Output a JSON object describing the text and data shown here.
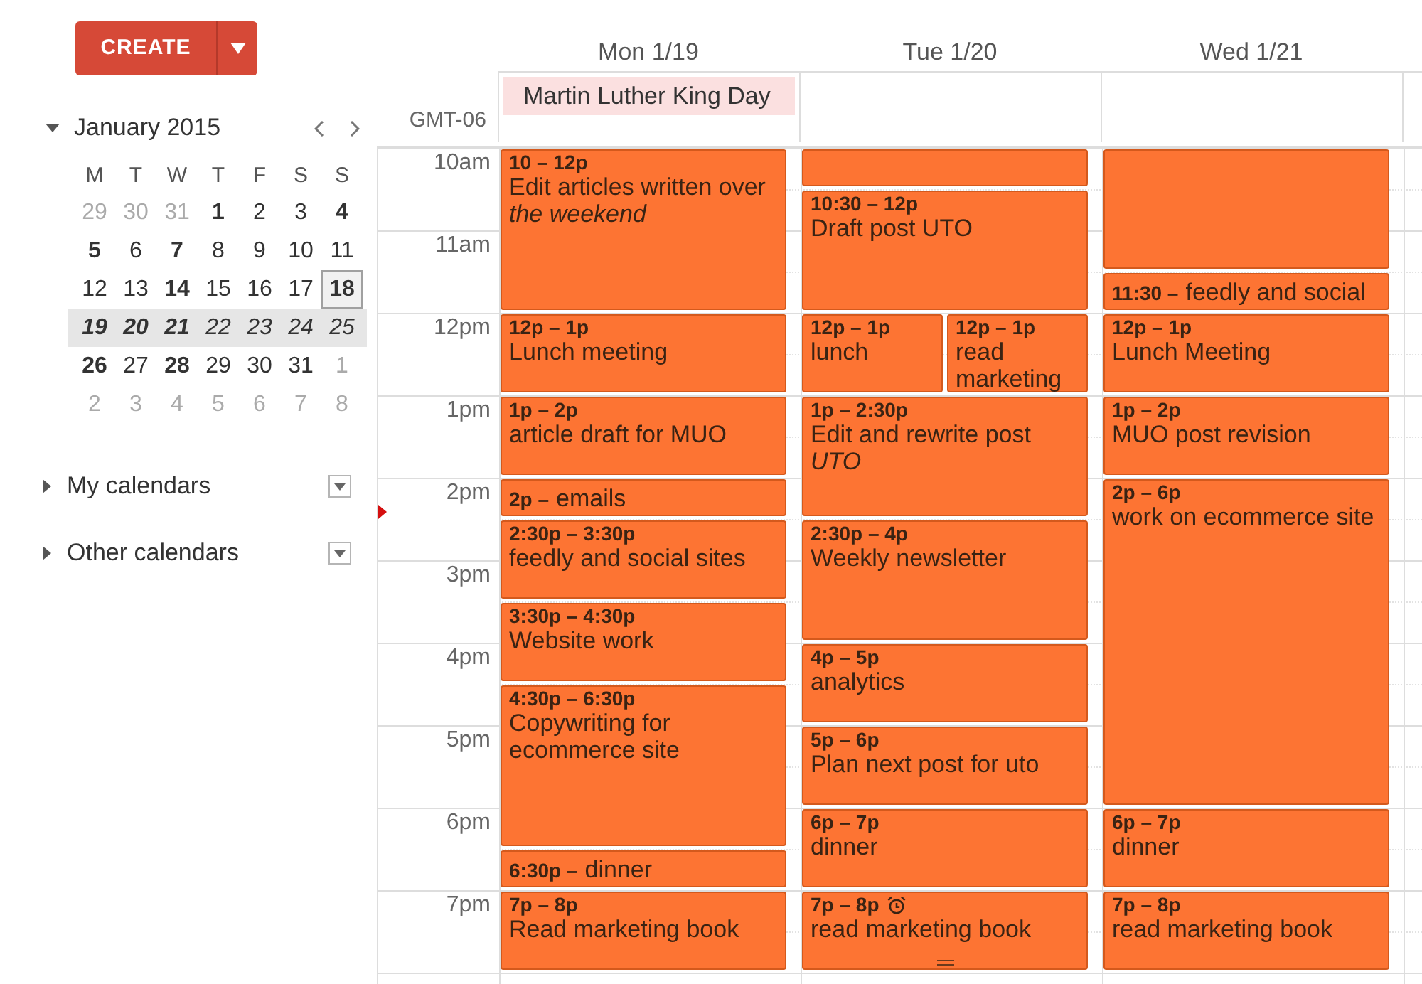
{
  "create_button": {
    "label": "CREATE"
  },
  "mini_calendar": {
    "title": "January 2015",
    "expanded": true,
    "weekdays": [
      "M",
      "T",
      "W",
      "T",
      "F",
      "S",
      "S"
    ],
    "weeks": [
      {
        "selected": false,
        "days": [
          {
            "label": "29",
            "muted": true,
            "bold": false,
            "today": false
          },
          {
            "label": "30",
            "muted": true,
            "bold": false,
            "today": false
          },
          {
            "label": "31",
            "muted": true,
            "bold": false,
            "today": false
          },
          {
            "label": "1",
            "muted": false,
            "bold": true,
            "today": false
          },
          {
            "label": "2",
            "muted": false,
            "bold": false,
            "today": false
          },
          {
            "label": "3",
            "muted": false,
            "bold": false,
            "today": false
          },
          {
            "label": "4",
            "muted": false,
            "bold": true,
            "today": false
          }
        ]
      },
      {
        "selected": false,
        "days": [
          {
            "label": "5",
            "muted": false,
            "bold": true,
            "today": false
          },
          {
            "label": "6",
            "muted": false,
            "bold": false,
            "today": false
          },
          {
            "label": "7",
            "muted": false,
            "bold": true,
            "today": false
          },
          {
            "label": "8",
            "muted": false,
            "bold": false,
            "today": false
          },
          {
            "label": "9",
            "muted": false,
            "bold": false,
            "today": false
          },
          {
            "label": "10",
            "muted": false,
            "bold": false,
            "today": false
          },
          {
            "label": "11",
            "muted": false,
            "bold": false,
            "today": false
          }
        ]
      },
      {
        "selected": false,
        "days": [
          {
            "label": "12",
            "muted": false,
            "bold": false,
            "today": false
          },
          {
            "label": "13",
            "muted": false,
            "bold": false,
            "today": false
          },
          {
            "label": "14",
            "muted": false,
            "bold": true,
            "today": false
          },
          {
            "label": "15",
            "muted": false,
            "bold": false,
            "today": false
          },
          {
            "label": "16",
            "muted": false,
            "bold": false,
            "today": false
          },
          {
            "label": "17",
            "muted": false,
            "bold": false,
            "today": false
          },
          {
            "label": "18",
            "muted": false,
            "bold": true,
            "today": true
          }
        ]
      },
      {
        "selected": true,
        "days": [
          {
            "label": "19",
            "muted": false,
            "bold": true,
            "today": false
          },
          {
            "label": "20",
            "muted": false,
            "bold": true,
            "today": false
          },
          {
            "label": "21",
            "muted": false,
            "bold": true,
            "today": false
          },
          {
            "label": "22",
            "muted": false,
            "bold": false,
            "today": false
          },
          {
            "label": "23",
            "muted": false,
            "bold": false,
            "today": false
          },
          {
            "label": "24",
            "muted": false,
            "bold": false,
            "today": false
          },
          {
            "label": "25",
            "muted": false,
            "bold": false,
            "today": false
          }
        ]
      },
      {
        "selected": false,
        "days": [
          {
            "label": "26",
            "muted": false,
            "bold": true,
            "today": false
          },
          {
            "label": "27",
            "muted": false,
            "bold": false,
            "today": false
          },
          {
            "label": "28",
            "muted": false,
            "bold": true,
            "today": false
          },
          {
            "label": "29",
            "muted": false,
            "bold": false,
            "today": false
          },
          {
            "label": "30",
            "muted": false,
            "bold": false,
            "today": false
          },
          {
            "label": "31",
            "muted": false,
            "bold": false,
            "today": false
          },
          {
            "label": "1",
            "muted": true,
            "bold": false,
            "today": false
          }
        ]
      },
      {
        "selected": false,
        "days": [
          {
            "label": "2",
            "muted": true,
            "bold": false,
            "today": false
          },
          {
            "label": "3",
            "muted": true,
            "bold": false,
            "today": false
          },
          {
            "label": "4",
            "muted": true,
            "bold": false,
            "today": false
          },
          {
            "label": "5",
            "muted": true,
            "bold": false,
            "today": false
          },
          {
            "label": "6",
            "muted": true,
            "bold": false,
            "today": false
          },
          {
            "label": "7",
            "muted": true,
            "bold": false,
            "today": false
          },
          {
            "label": "8",
            "muted": true,
            "bold": false,
            "today": false
          }
        ]
      }
    ]
  },
  "calendar_lists": [
    {
      "label": "My calendars",
      "expanded": false
    },
    {
      "label": "Other calendars",
      "expanded": false
    }
  ],
  "timezone": "GMT-06",
  "hours": [
    "10am",
    "11am",
    "12pm",
    "1pm",
    "2pm",
    "3pm",
    "4pm",
    "5pm",
    "6pm",
    "7pm"
  ],
  "days": [
    {
      "label": "Mon 1/19",
      "all_day": [
        "Martin Luther King Day"
      ],
      "rows": [
        {
          "kind": "double",
          "events": [
            {
              "time": "10 – 12p",
              "title": "Edit articles written over *the weekend*"
            }
          ]
        },
        {
          "kind": "hour",
          "events": [
            {
              "time": "12p – 1p",
              "title": "Lunch meeting"
            }
          ]
        },
        {
          "kind": "hour",
          "events": [
            {
              "time": "1p – 2p",
              "title": "article draft for MUO"
            }
          ]
        },
        {
          "kind": "half",
          "events": [
            {
              "time": "2p –",
              "title": "emails"
            }
          ]
        },
        {
          "kind": "hour",
          "events": [
            {
              "time": "2:30p – 3:30p",
              "title": "feedly and social sites"
            }
          ]
        },
        {
          "kind": "hour",
          "events": [
            {
              "time": "3:30p – 4:30p",
              "title": "Website work"
            }
          ]
        },
        {
          "kind": "double",
          "events": [
            {
              "time": "4:30p – 6:30p",
              "title": "Copywriting for ecommerce site"
            }
          ]
        },
        {
          "kind": "half",
          "events": [
            {
              "time": "6:30p –",
              "title": "dinner"
            }
          ]
        },
        {
          "kind": "hour",
          "events": [
            {
              "time": "7p – 8p",
              "title": "Read marketing book"
            }
          ]
        }
      ]
    },
    {
      "label": "Tue 1/20",
      "rows": [
        {
          "kind": "half"
        },
        {
          "kind": "ninety",
          "events": [
            {
              "time": "10:30 – 12p",
              "title": "Draft post UTO"
            }
          ]
        },
        {
          "kind": "hour",
          "events": [
            {
              "time": "12p – 1p",
              "title": "lunch"
            },
            {
              "time": "12p – 1p",
              "title": "read marketing"
            }
          ]
        },
        {
          "kind": "ninety",
          "events": [
            {
              "time": "1p – 2:30p",
              "title": "Edit and rewrite post *UTO*"
            }
          ]
        },
        {
          "kind": "ninety",
          "events": [
            {
              "time": "2:30p – 4p",
              "title": "Weekly newsletter"
            }
          ]
        },
        {
          "kind": "hour",
          "events": [
            {
              "time": "4p – 5p",
              "title": "analytics"
            }
          ]
        },
        {
          "kind": "hour",
          "events": [
            {
              "time": "5p – 6p",
              "title": "Plan next post for uto"
            }
          ]
        },
        {
          "kind": "hour",
          "events": [
            {
              "time": "6p – 7p",
              "title": "dinner"
            }
          ]
        },
        {
          "kind": "hour",
          "events": [
            {
              "time": "7p – 8p",
              "title": "read marketing book",
              "reminder": true,
              "resize_handle": true
            }
          ]
        }
      ]
    },
    {
      "label": "Wed 1/21",
      "rows": [
        {
          "kind": "ninety"
        },
        {
          "kind": "half",
          "events": [
            {
              "time": "11:30 –",
              "title": "feedly and social"
            }
          ]
        },
        {
          "kind": "hour",
          "events": [
            {
              "time": "12p – 1p",
              "title": "Lunch Meeting"
            }
          ]
        },
        {
          "kind": "hour",
          "events": [
            {
              "time": "1p – 2p",
              "title": "MUO post revision"
            }
          ]
        },
        {
          "kind": "quad",
          "events": [
            {
              "time": "2p – 6p",
              "title": "work on ecommerce site"
            }
          ]
        },
        {
          "kind": "hour",
          "events": [
            {
              "time": "6p – 7p",
              "title": "dinner"
            }
          ]
        },
        {
          "kind": "hour",
          "events": [
            {
              "time": "7p – 8p",
              "title": "read marketing book"
            }
          ]
        }
      ]
    }
  ]
}
